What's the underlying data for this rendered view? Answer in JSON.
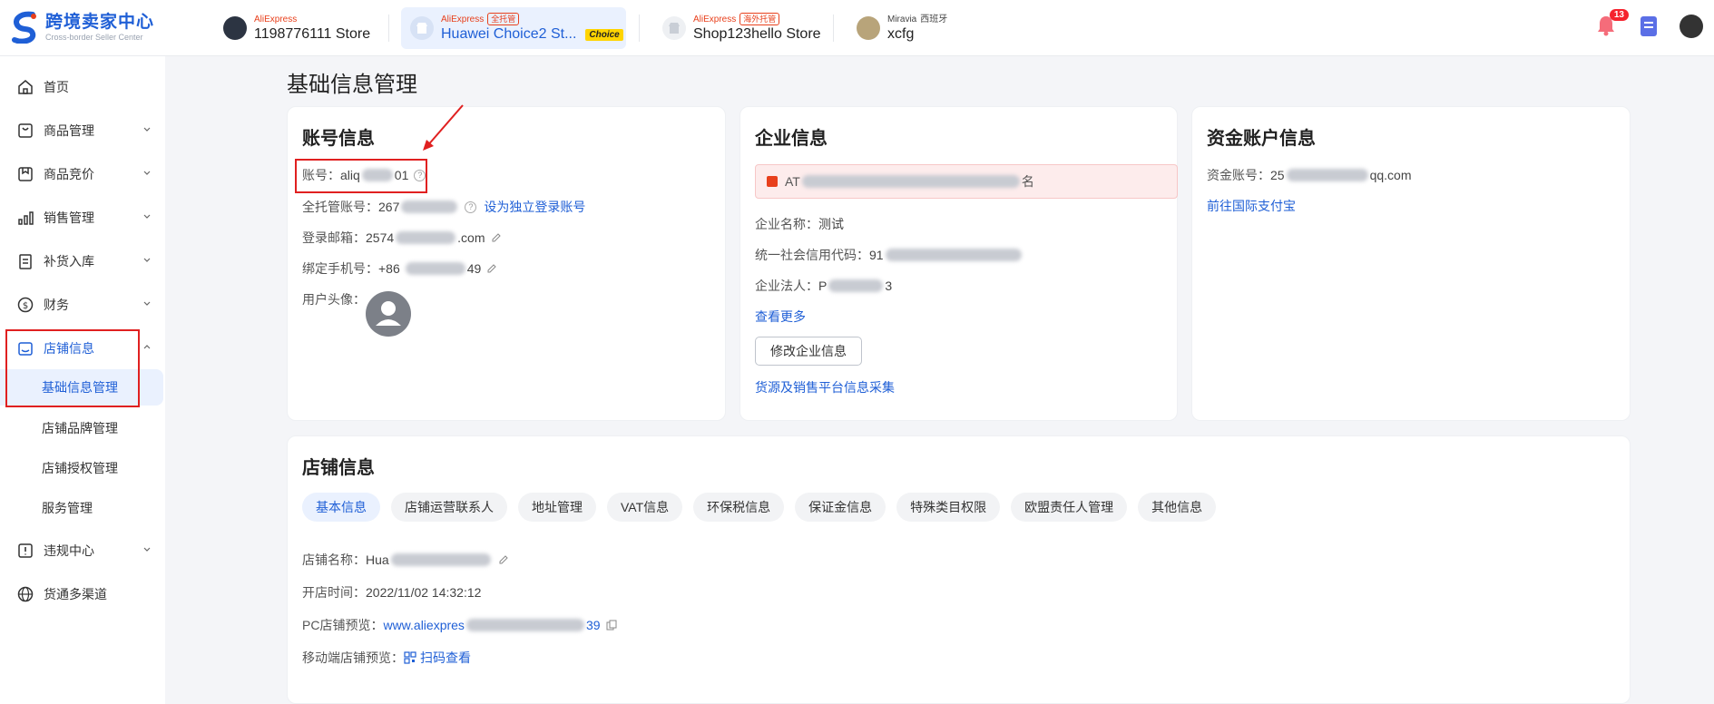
{
  "header": {
    "logo": {
      "title": "跨境卖家中心",
      "subtitle": "Cross-border Seller Center"
    },
    "stores": [
      {
        "brand": "AliExpress",
        "tag": "",
        "name": "1198776111 Store"
      },
      {
        "brand": "AliExpress",
        "tag": "全托管",
        "name": "Huawei Choice2 St...",
        "badge": "Choice"
      },
      {
        "brand": "AliExpress",
        "tag": "海外托管",
        "name": "Shop123hello Store"
      },
      {
        "brand": "Miravia",
        "tag": "西班牙",
        "name": "xcfg"
      }
    ],
    "notifications": "13"
  },
  "sidebar": {
    "items": [
      {
        "label": "首页"
      },
      {
        "label": "商品管理"
      },
      {
        "label": "商品竞价"
      },
      {
        "label": "销售管理"
      },
      {
        "label": "补货入库"
      },
      {
        "label": "财务"
      },
      {
        "label": "店铺信息"
      },
      {
        "label": "违规中心"
      },
      {
        "label": "货通多渠道"
      }
    ],
    "sub_items": [
      {
        "label": "基础信息管理"
      },
      {
        "label": "店铺品牌管理"
      },
      {
        "label": "店铺授权管理"
      },
      {
        "label": "服务管理"
      }
    ]
  },
  "page": {
    "title": "基础信息管理"
  },
  "account_card": {
    "title": "账号信息",
    "account_label": "账号：",
    "account_value_prefix": "aliq",
    "account_value_suffix": "01",
    "managed_label": "全托管账号：",
    "managed_value_prefix": "267",
    "set_login_link": "设为独立登录账号",
    "email_label": "登录邮箱：",
    "email_value_prefix": "2574",
    "email_value_suffix": ".com",
    "phone_label": "绑定手机号：",
    "phone_value_prefix": "+86",
    "phone_value_suffix": "49",
    "avatar_label": "用户头像："
  },
  "company_card": {
    "title": "企业信息",
    "warning_prefix": "AT",
    "warning_suffix": "名",
    "name_label": "企业名称：",
    "name_value": "测试",
    "credit_label": "统一社会信用代码：",
    "credit_value_prefix": "91",
    "legal_label": "企业法人：",
    "legal_value_prefix": "P",
    "legal_value_suffix": "3",
    "more_link": "查看更多",
    "edit_button": "修改企业信息",
    "collect_link": "货源及销售平台信息采集"
  },
  "fund_card": {
    "title": "资金账户信息",
    "account_label": "资金账号：",
    "account_value_prefix": "25",
    "account_value_suffix": "qq.com",
    "alipay_link": "前往国际支付宝"
  },
  "store_card": {
    "title": "店铺信息",
    "tabs": [
      "基本信息",
      "店铺运营联系人",
      "地址管理",
      "VAT信息",
      "环保税信息",
      "保证金信息",
      "特殊类目权限",
      "欧盟责任人管理",
      "其他信息"
    ],
    "store_name_label": "店铺名称：",
    "store_name_prefix": "Hua",
    "open_time_label": "开店时间：",
    "open_time_value": "2022/11/02 14:32:12",
    "pc_preview_label": "PC店铺预览：",
    "pc_preview_prefix": "www.aliexpres",
    "pc_preview_suffix": "39",
    "mobile_preview_label": "移动端店铺预览：",
    "scan_link": "扫码查看"
  },
  "colors": {
    "accent": "#1f5fd6",
    "highlight": "#e02020",
    "brand": "#e8401c"
  }
}
